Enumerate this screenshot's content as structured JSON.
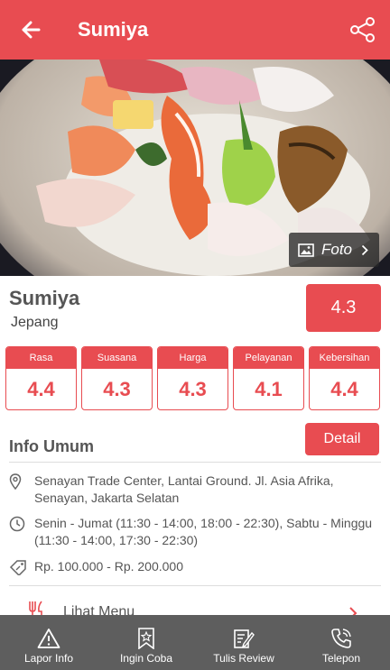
{
  "header": {
    "title": "Sumiya",
    "back_icon": "back-arrow-icon",
    "share_icon": "share-icon"
  },
  "hero": {
    "photo_label": "Foto",
    "photo_icon": "image-icon"
  },
  "restaurant": {
    "name": "Sumiya",
    "cuisine": "Jepang",
    "rating": "4.3"
  },
  "ratings": [
    {
      "label": "Rasa",
      "value": "4.4"
    },
    {
      "label": "Suasana",
      "value": "4.3"
    },
    {
      "label": "Harga",
      "value": "4.3"
    },
    {
      "label": "Pelayanan",
      "value": "4.1"
    },
    {
      "label": "Kebersihan",
      "value": "4.4"
    }
  ],
  "info": {
    "title": "Info Umum",
    "detail_label": "Detail",
    "address": "Senayan Trade Center, Lantai Ground. Jl. Asia Afrika, Senayan, Jakarta Selatan",
    "hours": "Senin - Jumat (11:30 - 14:00, 18:00 - 22:30), Sabtu - Minggu (11:30 - 14:00, 17:30 - 22:30)",
    "price": "Rp. 100.000 - Rp. 200.000",
    "menu_label": "Lihat Menu"
  },
  "bottom_nav": [
    {
      "label": "Lapor Info",
      "icon": "warning-icon"
    },
    {
      "label": "Ingin Coba",
      "icon": "bookmark-star-icon"
    },
    {
      "label": "Tulis Review",
      "icon": "write-review-icon"
    },
    {
      "label": "Telepon",
      "icon": "phone-icon"
    }
  ],
  "colors": {
    "accent": "#e84c51",
    "nav_bg": "#5e5e5e",
    "text": "#555555"
  }
}
